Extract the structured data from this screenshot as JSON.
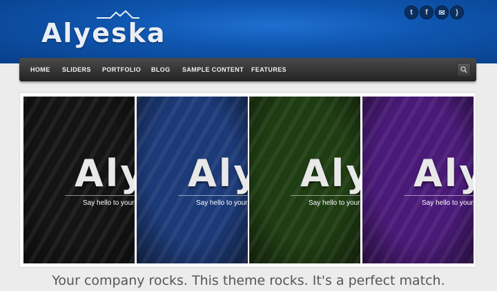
{
  "brand": {
    "name": "Alyeska"
  },
  "social": [
    {
      "icon": "twitter-icon",
      "glyph": "t"
    },
    {
      "icon": "facebook-icon",
      "glyph": "f"
    },
    {
      "icon": "mail-icon",
      "glyph": "✉"
    },
    {
      "icon": "rss-icon",
      "glyph": ")"
    }
  ],
  "nav": {
    "items": [
      "HOME",
      "SLIDERS",
      "PORTFOLIO",
      "BLOG",
      "SAMPLE CONTENT",
      "FEATURES"
    ],
    "search_icon": "search-icon"
  },
  "slider": {
    "panels": [
      {
        "brand": "Alyeska",
        "tagline": "Say hello to your",
        "color": "#141414"
      },
      {
        "brand": "Alyeska",
        "tagline": "Say hello to your",
        "color": "#1c3a78"
      },
      {
        "brand": "Alyeska",
        "tagline": "Say hello to your",
        "color": "#1f3d12"
      },
      {
        "brand": "Alyeska",
        "tagline": "Say hello to your",
        "color": "#4a1a78"
      }
    ]
  },
  "tagline": "Your company rocks. This theme rocks. It's a perfect match."
}
